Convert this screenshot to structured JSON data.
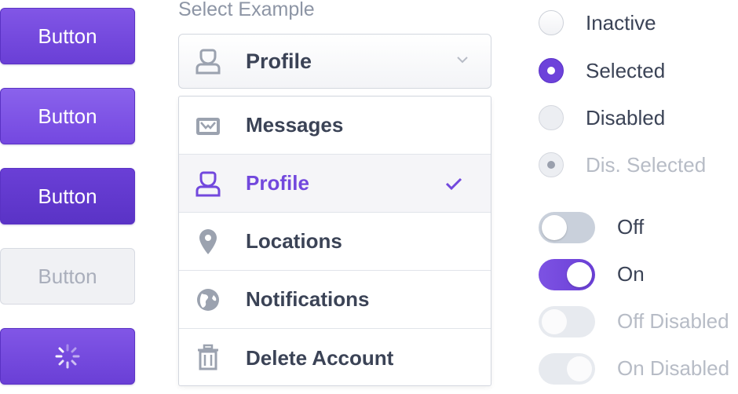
{
  "buttons": [
    {
      "label": "Button",
      "state": "default"
    },
    {
      "label": "Button",
      "state": "hover"
    },
    {
      "label": "Button",
      "state": "active"
    },
    {
      "label": "Button",
      "state": "disabled"
    },
    {
      "label": "",
      "state": "loading",
      "icon": "spinner-icon"
    }
  ],
  "select": {
    "label": "Select Example",
    "value": "Profile",
    "value_icon": "profile-icon",
    "chevron_icon": "chevron-down-icon",
    "options": [
      {
        "label": "Messages",
        "icon": "messages-icon",
        "selected": false
      },
      {
        "label": "Profile",
        "icon": "profile-icon",
        "selected": true
      },
      {
        "label": "Locations",
        "icon": "location-pin-icon",
        "selected": false
      },
      {
        "label": "Notifications",
        "icon": "globe-icon",
        "selected": false
      },
      {
        "label": "Delete Account",
        "icon": "trash-icon",
        "selected": false
      }
    ]
  },
  "radios": [
    {
      "label": "Inactive",
      "checked": false,
      "disabled": false
    },
    {
      "label": "Selected",
      "checked": true,
      "disabled": false
    },
    {
      "label": "Disabled",
      "checked": false,
      "disabled": true
    },
    {
      "label": "Dis. Selected",
      "checked": true,
      "disabled": true
    }
  ],
  "toggles": [
    {
      "label": "Off",
      "on": false,
      "disabled": false
    },
    {
      "label": "On",
      "on": true,
      "disabled": false
    },
    {
      "label": "Off Disabled",
      "on": false,
      "disabled": true
    },
    {
      "label": "On Disabled",
      "on": true,
      "disabled": true
    }
  ],
  "colors": {
    "accent": "#6d42da",
    "text": "#3b4356",
    "muted": "#b7bcc6",
    "border": "#d3d7df"
  }
}
